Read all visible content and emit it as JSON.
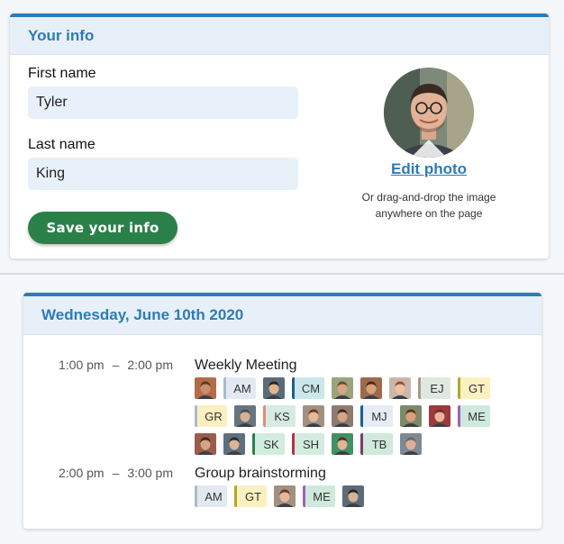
{
  "your_info": {
    "title": "Your info",
    "first_name_label": "First name",
    "first_name_value": "Tyler",
    "last_name_label": "Last name",
    "last_name_value": "King",
    "save_label": "Save your info",
    "edit_photo_label": "Edit photo",
    "drop_hint": "Or drag-and-drop the image anywhere on the page"
  },
  "schedule": {
    "date_title": "Wednesday, June 10th 2020",
    "events": [
      {
        "start": "1:00 pm",
        "end": "2:00 pm",
        "title": "Weekly Meeting",
        "attendees": [
          {
            "type": "avatar",
            "skin": "#c8916c",
            "hair": "#5a3a22",
            "bg": "#b56a4a"
          },
          {
            "type": "initials",
            "text": "AM",
            "bg": "#e3e9f1",
            "border": "#a9bad0"
          },
          {
            "type": "avatar",
            "skin": "#e0b48f",
            "hair": "#2a2420",
            "bg": "#5c6b78"
          },
          {
            "type": "initials",
            "text": "CM",
            "bg": "#cbe7ea",
            "border": "#1f5f8f"
          },
          {
            "type": "avatar",
            "skin": "#d9a683",
            "hair": "#6b4a30",
            "bg": "#9aa47c"
          },
          {
            "type": "avatar",
            "skin": "#d7a07c",
            "hair": "#4a2a1c",
            "bg": "#9c6b4e"
          },
          {
            "type": "avatar",
            "skin": "#eec0a1",
            "hair": "#9a4d2a",
            "bg": "#c9b8aa"
          },
          {
            "type": "initials",
            "text": "EJ",
            "bg": "#dfe9e1",
            "border": "#a99a87"
          },
          {
            "type": "initials",
            "text": "GT",
            "bg": "#fbf0bf",
            "border": "#b3a62c"
          },
          {
            "type": "initials",
            "text": "GR",
            "bg": "#fbf0bf",
            "border": "#a9bad0"
          },
          {
            "type": "avatar",
            "skin": "#d8b292",
            "hair": "#4a5058",
            "bg": "#6a7480"
          },
          {
            "type": "initials",
            "text": "KS",
            "bg": "#d8ebe2",
            "border": "#e08c7c"
          },
          {
            "type": "avatar",
            "skin": "#e6b89a",
            "hair": "#6a3a22",
            "bg": "#a29080"
          },
          {
            "type": "avatar",
            "skin": "#d6a585",
            "hair": "#3a2a22",
            "bg": "#8f7a70"
          },
          {
            "type": "initials",
            "text": "MJ",
            "bg": "#e5ecf6",
            "border": "#1f5f8f"
          },
          {
            "type": "avatar",
            "skin": "#d9a07e",
            "hair": "#5a3422",
            "bg": "#7d8a6a"
          },
          {
            "type": "avatar",
            "skin": "#e8b79b",
            "hair": "#7a2a2a",
            "bg": "#9b3b3b"
          },
          {
            "type": "initials",
            "text": "ME",
            "bg": "#cfe9dc",
            "border": "#9a63b5"
          },
          {
            "type": "avatar",
            "skin": "#d7a386",
            "hair": "#3e2a20",
            "bg": "#9b5d4b"
          },
          {
            "type": "avatar",
            "skin": "#dcb49a",
            "hair": "#2d2a28",
            "bg": "#5e6f80"
          },
          {
            "type": "initials",
            "text": "SK",
            "bg": "#d2ecdf",
            "border": "#2b8049"
          },
          {
            "type": "initials",
            "text": "SH",
            "bg": "#d2ecdf",
            "border": "#b8323a"
          },
          {
            "type": "avatar",
            "skin": "#e3b394",
            "hair": "#4c3424",
            "bg": "#3f9266"
          },
          {
            "type": "initials",
            "text": "TB",
            "bg": "#cfe9dc",
            "border": "#7a3c6a"
          },
          {
            "type": "avatar",
            "skin": "#ddb196",
            "hair": "#6a6a68",
            "bg": "#7e8a92"
          }
        ]
      },
      {
        "start": "2:00 pm",
        "end": "3:00 pm",
        "title": "Group brainstorming",
        "attendees": [
          {
            "type": "initials",
            "text": "AM",
            "bg": "#e3e9f1",
            "border": "#a9bad0"
          },
          {
            "type": "initials",
            "text": "GT",
            "bg": "#fbf0bf",
            "border": "#b3a62c"
          },
          {
            "type": "avatar",
            "skin": "#e6b89a",
            "hair": "#6a3a22",
            "bg": "#a29080"
          },
          {
            "type": "initials",
            "text": "ME",
            "bg": "#cfe9dc",
            "border": "#9a63b5"
          },
          {
            "type": "avatar",
            "skin": "#d8b292",
            "hair": "#2a2420",
            "bg": "#5c6b78"
          }
        ]
      }
    ]
  }
}
